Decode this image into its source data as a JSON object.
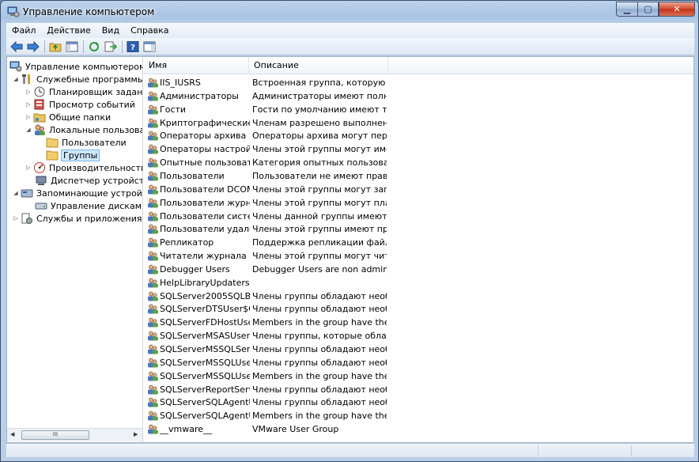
{
  "window": {
    "title": "Управление компьютером"
  },
  "menu": [
    {
      "label": "Файл"
    },
    {
      "label": "Действие"
    },
    {
      "label": "Вид"
    },
    {
      "label": "Справка"
    }
  ],
  "tree": {
    "items": [
      {
        "label": "Управление компьютером (л",
        "icon": "computer-management-icon"
      },
      {
        "label": "Служебные программы",
        "icon": "tools-icon"
      },
      {
        "label": "Планировщик заданий",
        "icon": "clock-icon"
      },
      {
        "label": "Просмотр событий",
        "icon": "event-viewer-icon"
      },
      {
        "label": "Общие папки",
        "icon": "shared-folder-icon"
      },
      {
        "label": "Локальные пользовате",
        "icon": "users-icon"
      },
      {
        "label": "Пользователи",
        "icon": "folder-icon"
      },
      {
        "label": "Группы",
        "icon": "folder-icon"
      },
      {
        "label": "Производительность",
        "icon": "performance-icon"
      },
      {
        "label": "Диспетчер устройств",
        "icon": "device-manager-icon"
      },
      {
        "label": "Запоминающие устройст",
        "icon": "storage-icon"
      },
      {
        "label": "Управление дисками",
        "icon": "disk-icon"
      },
      {
        "label": "Службы и приложения",
        "icon": "services-icon"
      }
    ]
  },
  "list": {
    "columns": [
      {
        "label": "Имя"
      },
      {
        "label": "Описание"
      }
    ],
    "rows": [
      {
        "name": "IIS_IUSRS",
        "desc": "Встроенная группа, которую ис..."
      },
      {
        "name": "Администраторы",
        "desc": "Администраторы имеют полны..."
      },
      {
        "name": "Гости",
        "desc": "Гости по умолчанию имеют те ..."
      },
      {
        "name": "Криптографические ...",
        "desc": "Членам разрешено выполнени..."
      },
      {
        "name": "Операторы архива",
        "desc": "Операторы архива могут перек..."
      },
      {
        "name": "Операторы настройк...",
        "desc": "Члены этой группы могут имет..."
      },
      {
        "name": "Опытные пользовате...",
        "desc": "Категория опытных пользовате..."
      },
      {
        "name": "Пользователи",
        "desc": "Пользователи не имеют прав на..."
      },
      {
        "name": "Пользователи DCOM",
        "desc": "Члены этой группы могут запус..."
      },
      {
        "name": "Пользователи журна...",
        "desc": "Члены этой группы могут план..."
      },
      {
        "name": "Пользователи систе...",
        "desc": "Члены данной группы имеют ка..."
      },
      {
        "name": "Пользователи удале...",
        "desc": "Члены этой группы имеют прав..."
      },
      {
        "name": "Репликатор",
        "desc": "Поддержка репликации файлов..."
      },
      {
        "name": "Читатели журнала с...",
        "desc": "Члены этой группы могут читат..."
      },
      {
        "name": "Debugger Users",
        "desc": "Debugger Users are non administr..."
      },
      {
        "name": "HelpLibraryUpdaters",
        "desc": ""
      },
      {
        "name": "SQLServer2005SQLBro...",
        "desc": "Члены группы обладают необх..."
      },
      {
        "name": "SQLServerDTSUser$C...",
        "desc": "Члены группы обладают необх..."
      },
      {
        "name": "SQLServerFDHostUser...",
        "desc": "Members in the group have the re..."
      },
      {
        "name": "SQLServerMSASUser$...",
        "desc": "Члены группы, которые облада..."
      },
      {
        "name": "SQLServerMSSQLServ...",
        "desc": "Члены группы обладают необх..."
      },
      {
        "name": "SQLServerMSSQLUser...",
        "desc": "Члены группы обладают необх..."
      },
      {
        "name": "SQLServerMSSQLUser...",
        "desc": "Members in the group have the re..."
      },
      {
        "name": "SQLServerReportServe...",
        "desc": "Члены группы обладают необх..."
      },
      {
        "name": "SQLServerSQLAgentU...",
        "desc": "Члены группы обладают необх..."
      },
      {
        "name": "SQLServerSQLAgentU...",
        "desc": "Members in the group have the re..."
      },
      {
        "name": "__vmware__",
        "desc": "VMware User Group"
      }
    ]
  },
  "scrollbar": {
    "grip": "III"
  }
}
